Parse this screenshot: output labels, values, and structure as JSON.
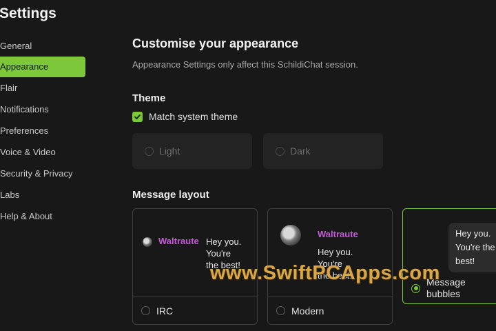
{
  "page": {
    "title": "Settings"
  },
  "sidebar": {
    "items": [
      {
        "label": "General",
        "active": false
      },
      {
        "label": "Appearance",
        "active": true
      },
      {
        "label": "Flair",
        "active": false
      },
      {
        "label": "Notifications",
        "active": false
      },
      {
        "label": "Preferences",
        "active": false
      },
      {
        "label": "Voice & Video",
        "active": false
      },
      {
        "label": "Security & Privacy",
        "active": false
      },
      {
        "label": "Labs",
        "active": false
      },
      {
        "label": "Help & About",
        "active": false
      }
    ]
  },
  "main": {
    "heading": "Customise your appearance",
    "subheading": "Appearance Settings only affect this SchildiChat session.",
    "theme": {
      "heading": "Theme",
      "match_system_label": "Match system theme",
      "match_system_checked": true,
      "options": [
        {
          "label": "Light",
          "selected": false
        },
        {
          "label": "Dark",
          "selected": false
        }
      ]
    },
    "message_layout": {
      "heading": "Message layout",
      "sample": {
        "sender": "Waltraute",
        "message": "Hey you. You're the best!",
        "message_lines": [
          "Hey you.",
          "You're",
          "the best!"
        ],
        "bubble_lines": [
          "Hey you.",
          "You're the",
          "best!"
        ]
      },
      "options": [
        {
          "label": "IRC",
          "selected": false
        },
        {
          "label": "Modern",
          "selected": false
        },
        {
          "label": "Message bubbles",
          "label_lines": [
            "Message",
            "bubbles"
          ],
          "selected": true
        }
      ]
    }
  },
  "overlay": {
    "watermark": "www.SwiftPCApps.com"
  },
  "colors": {
    "accent": "#7cc83a",
    "sender": "#c35ad8",
    "background": "#181818",
    "watermark": "#d9a64a"
  }
}
